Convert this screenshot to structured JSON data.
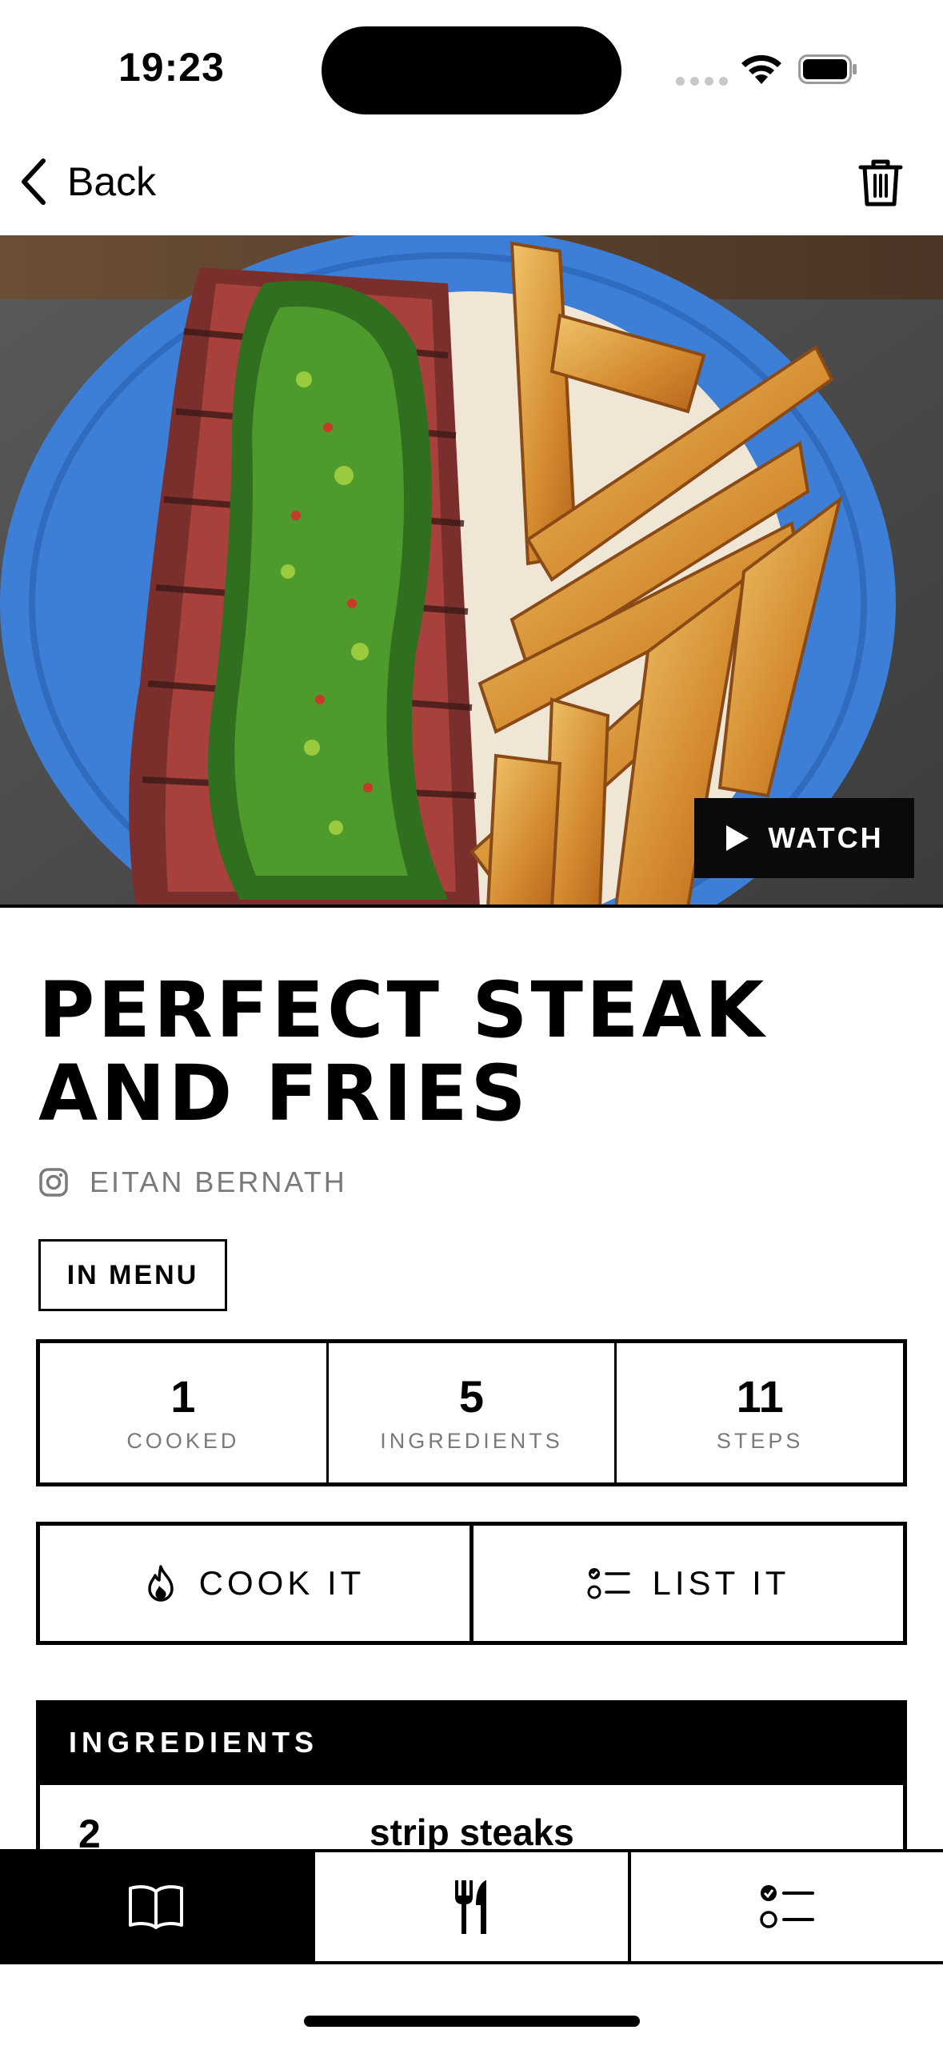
{
  "status_bar": {
    "time": "19:23"
  },
  "nav": {
    "back_label": "Back"
  },
  "hero": {
    "watch_label": "WATCH"
  },
  "recipe": {
    "title_line1": "PERFECT STEAK",
    "title_line2": "AND FRIES",
    "author": "EITAN BERNATH",
    "menu_badge": "IN MENU"
  },
  "stats": [
    {
      "value": "1",
      "label": "COOKED"
    },
    {
      "value": "5",
      "label": "INGREDIENTS"
    },
    {
      "value": "11",
      "label": "STEPS"
    }
  ],
  "actions": {
    "cook_label": "COOK IT",
    "list_label": "LIST IT"
  },
  "ingredients": {
    "header": "INGREDIENTS",
    "items": [
      {
        "qty": "2",
        "name": "strip steaks"
      }
    ]
  },
  "icons": {
    "back": "chevron-left-icon",
    "trash": "trash-icon",
    "play": "play-icon",
    "instagram": "instagram-icon",
    "flame": "flame-icon",
    "checklist": "checklist-icon",
    "book": "book-icon",
    "utensils": "utensils-icon"
  },
  "colors": {
    "accent": "#000000",
    "muted_text": "#7a7a7a",
    "plate_blue": "#3d7fd6"
  }
}
